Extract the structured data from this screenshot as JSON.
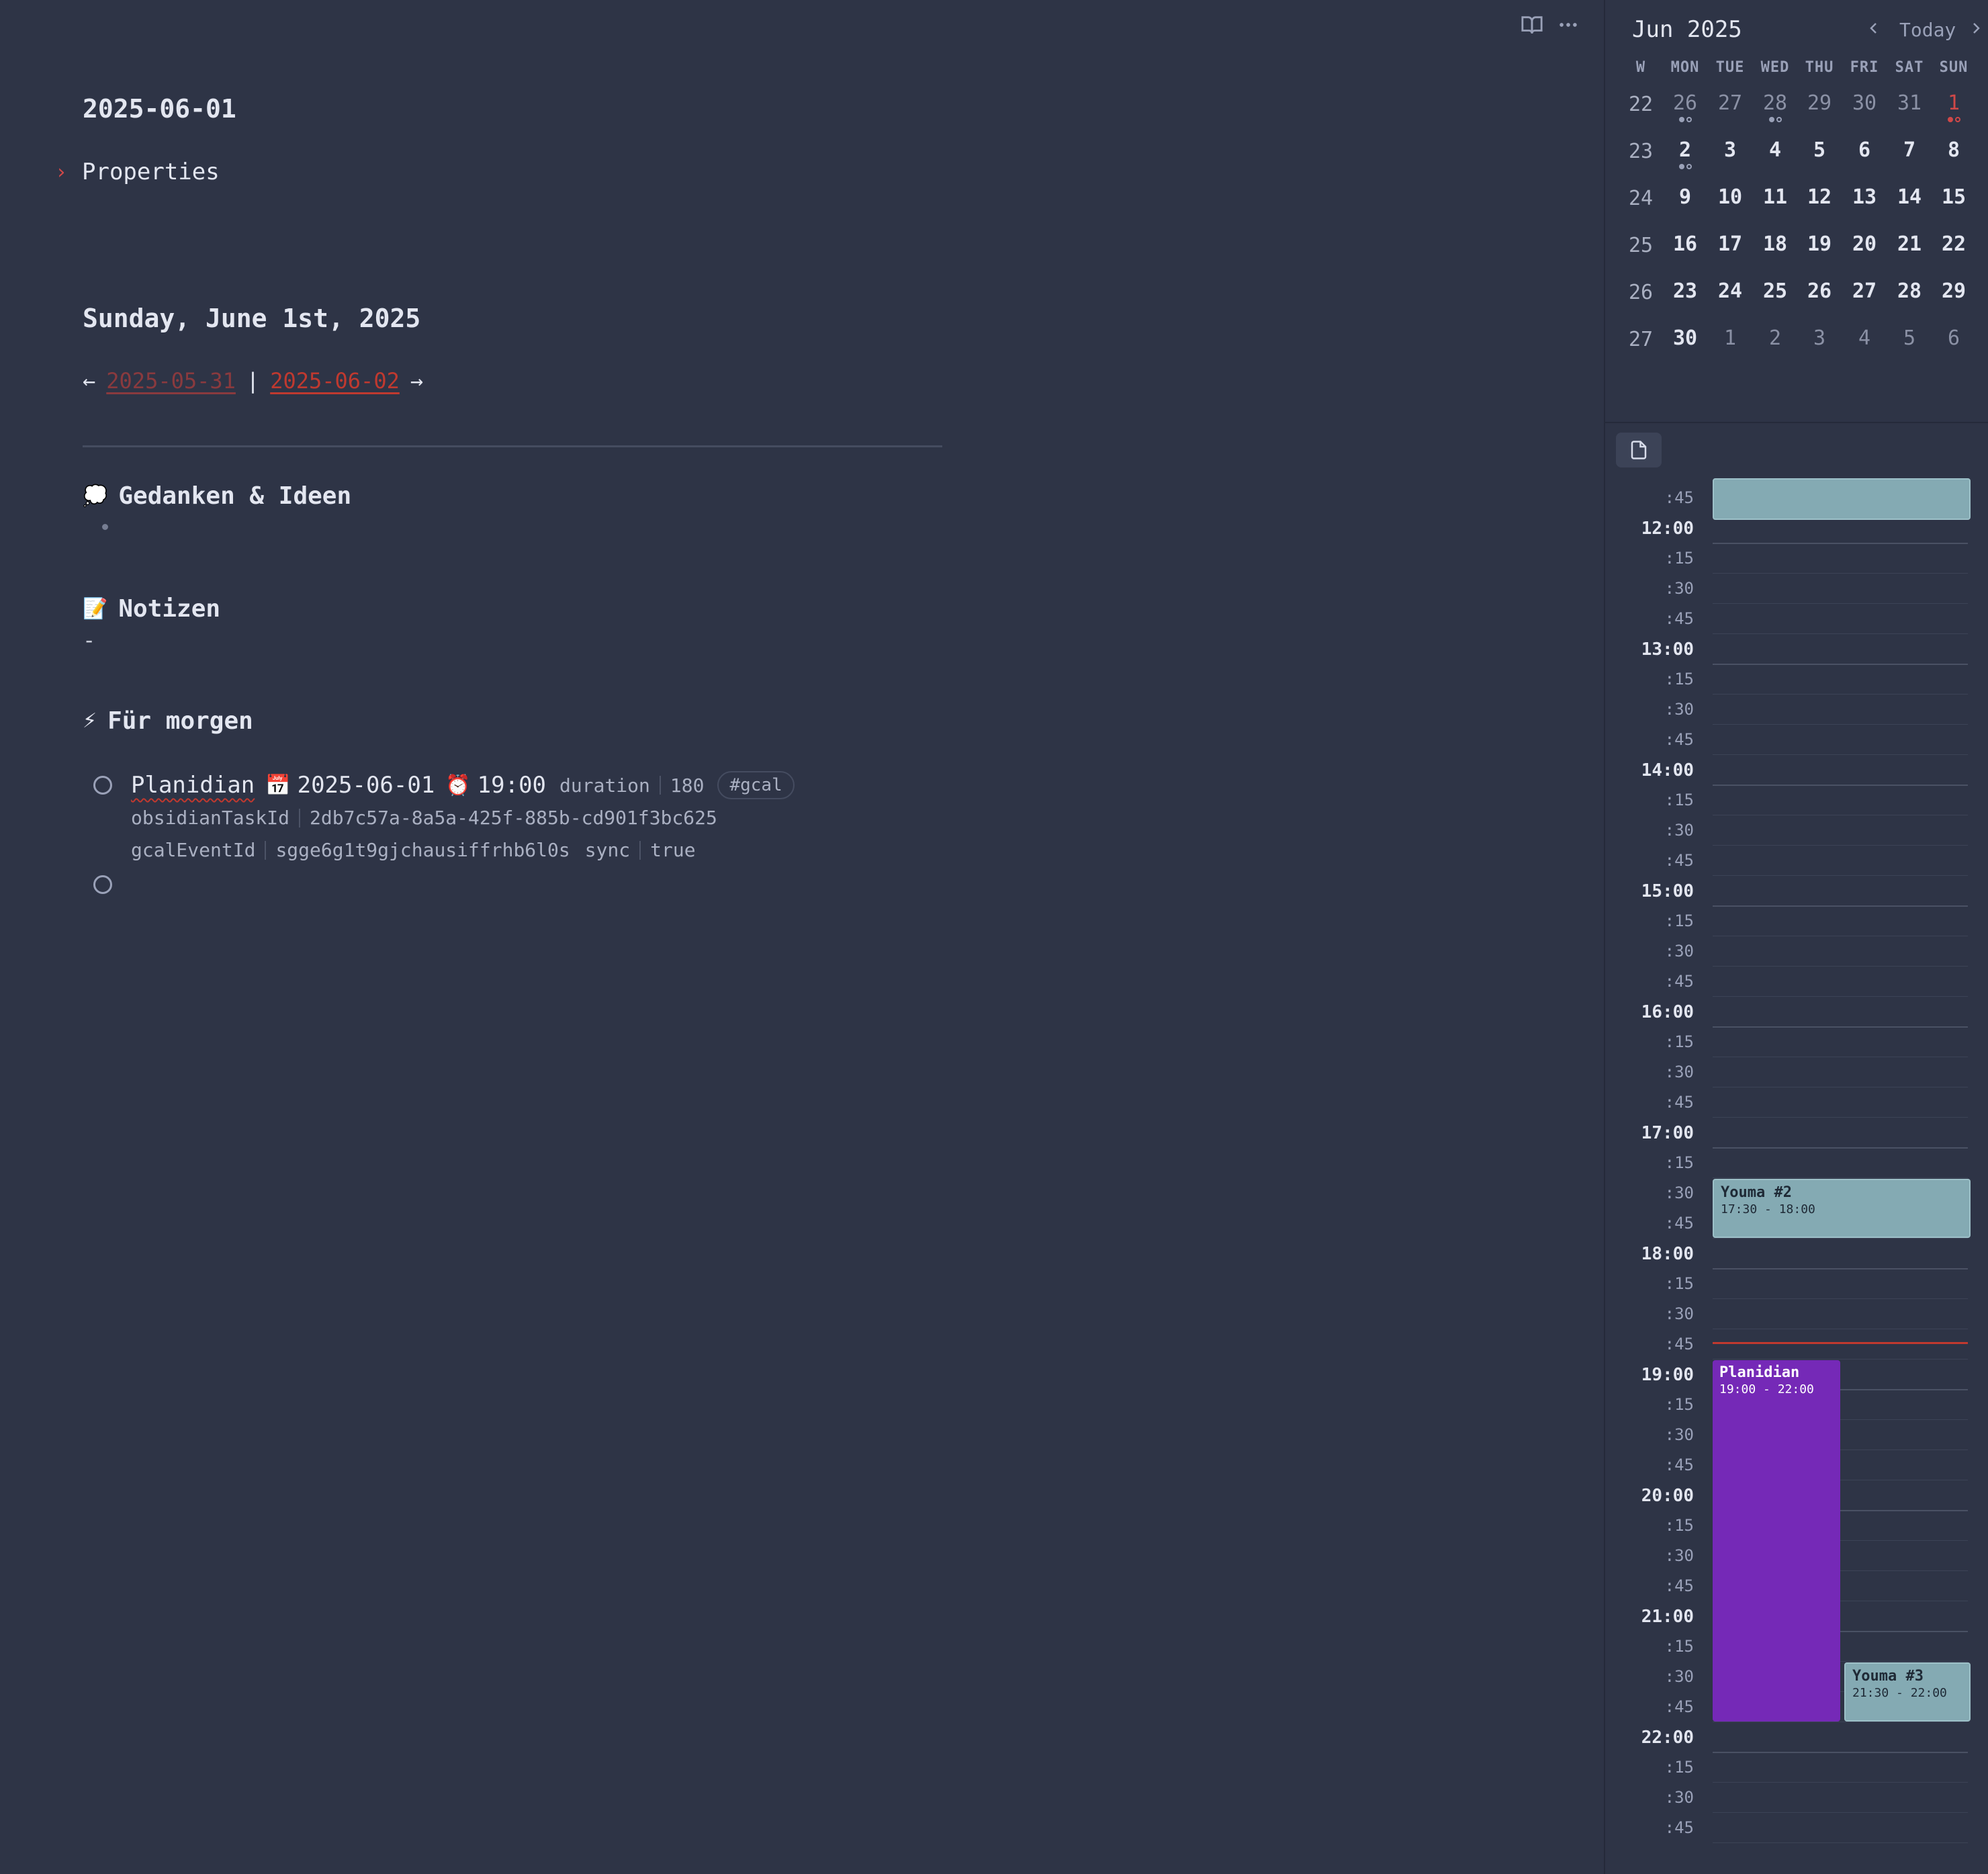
{
  "note": {
    "title": "2025-06-01",
    "properties_label": "Properties",
    "date_heading": "Sunday, June 1st, 2025",
    "nav": {
      "prev_arrow": "←",
      "prev": "2025-05-31",
      "sep": "|",
      "next": "2025-06-02",
      "next_arrow": "→"
    },
    "sections": {
      "ideas": {
        "emoji": "💭",
        "title": "Gedanken & Ideen"
      },
      "notes": {
        "emoji": "📝",
        "title": "Notizen",
        "content": "-"
      },
      "tomorrow": {
        "emoji": "⚡",
        "title": "Für morgen"
      }
    },
    "task": {
      "name": "Planidian",
      "cal_emoji": "📅",
      "date": "2025-06-01",
      "clock_emoji": "⏰",
      "time": "19:00",
      "fields": [
        {
          "key": "duration",
          "value": "180"
        },
        {
          "key": "obsidianTaskId",
          "value": "2db7c57a-8a5a-425f-885b-cd901f3bc625"
        },
        {
          "key": "gcalEventId",
          "value": "sgge6g1t9gjchausiffrhb6l0s"
        },
        {
          "key": "sync",
          "value": "true"
        }
      ],
      "tag": "#gcal"
    }
  },
  "calendar": {
    "month_title": "Jun 2025",
    "today_label": "Today",
    "prev_icon": "chevron-left-icon",
    "next_icon": "chevron-right-icon",
    "headers": [
      "W",
      "MON",
      "TUE",
      "WED",
      "THU",
      "FRI",
      "SAT",
      "SUN"
    ],
    "weeks": [
      {
        "w": "22",
        "days": [
          "26",
          "27",
          "28",
          "29",
          "30",
          "31",
          "1"
        ]
      },
      {
        "w": "23",
        "days": [
          "2",
          "3",
          "4",
          "5",
          "6",
          "7",
          "8"
        ]
      },
      {
        "w": "24",
        "days": [
          "9",
          "10",
          "11",
          "12",
          "13",
          "14",
          "15"
        ]
      },
      {
        "w": "25",
        "days": [
          "16",
          "17",
          "18",
          "19",
          "20",
          "21",
          "22"
        ]
      },
      {
        "w": "26",
        "days": [
          "23",
          "24",
          "25",
          "26",
          "27",
          "28",
          "29"
        ]
      },
      {
        "w": "27",
        "days": [
          "30",
          "1",
          "2",
          "3",
          "4",
          "5",
          "6"
        ]
      }
    ]
  },
  "timeline": {
    "labels": [
      ":45",
      "12:00",
      ":15",
      ":30",
      ":45",
      "13:00",
      ":15",
      ":30",
      ":45",
      "14:00",
      ":15",
      ":30",
      ":45",
      "15:00",
      ":15",
      ":30",
      ":45",
      "16:00",
      ":15",
      ":30",
      ":45",
      "17:00",
      ":15",
      ":30",
      ":45",
      "18:00",
      ":15",
      ":30",
      ":45",
      "19:00",
      ":15",
      ":30",
      ":45",
      "20:00",
      ":15",
      ":30",
      ":45",
      "21:00",
      ":15",
      ":30",
      ":45",
      "22:00",
      ":15",
      ":30",
      ":45"
    ],
    "events": [
      {
        "title": "Youma #2",
        "time": "17:30 - 18:00"
      },
      {
        "title": "Planidian",
        "time": "19:00 - 22:00"
      },
      {
        "title": "Youma #3",
        "time": "21:30 - 22:00"
      }
    ]
  },
  "colors": {
    "accent": "#c0392f",
    "event_teal": "#84aab3",
    "event_purple": "#7529b7",
    "background": "#2e3446"
  }
}
